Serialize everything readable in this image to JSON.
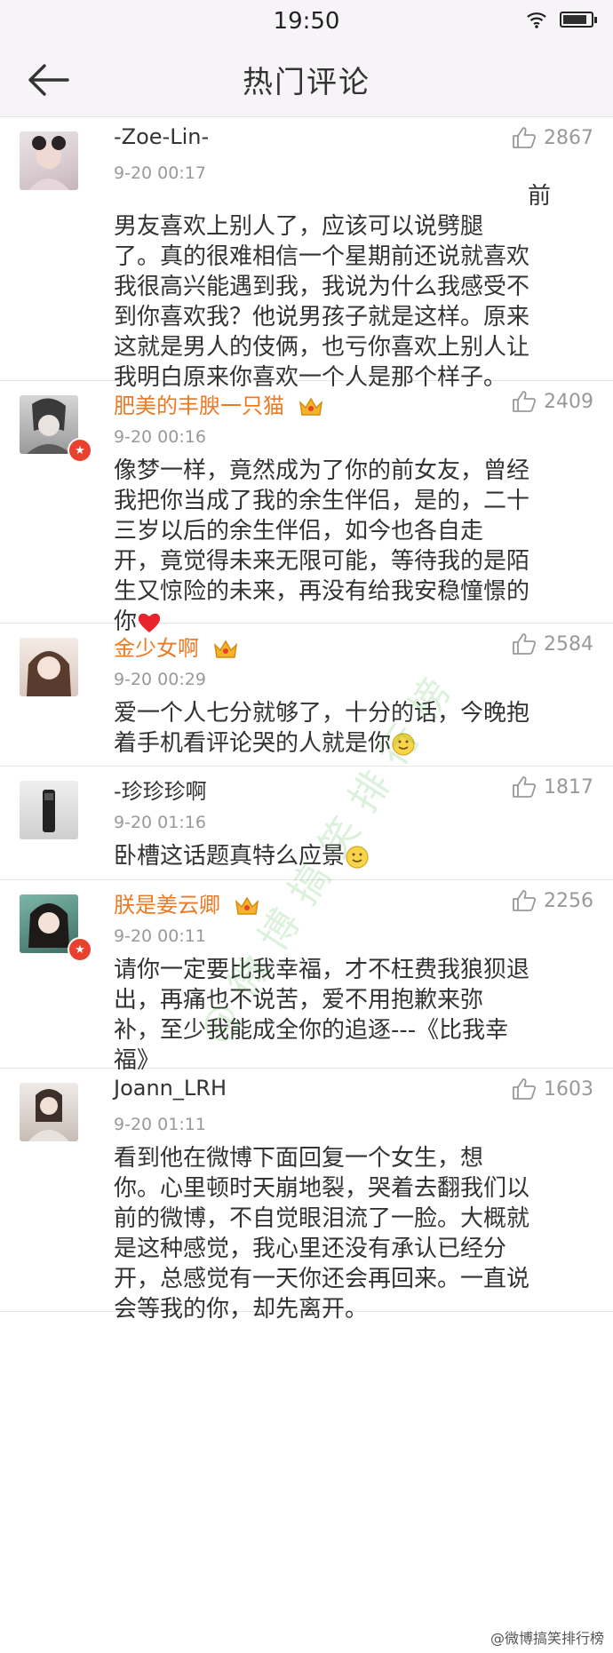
{
  "status": {
    "time": "19:50"
  },
  "header": {
    "title": "热门评论"
  },
  "comments": [
    {
      "name": "-Zoe-Lin-",
      "time": "9-20 00:17",
      "likes": "2867",
      "vip": false,
      "verified": false,
      "lines": [
        "前",
        "男友喜欢上别人了，应该可以说劈腿",
        "了。真的很难相信一个星期前还说就喜欢",
        "我很高兴能遇到我，我说为什么我感受不",
        "到你喜欢我？他说男孩子就是这样。原来",
        "这就是男人的伎俩，也亏你喜欢上别人让",
        "我明白原来你喜欢一个人是那个样子。"
      ]
    },
    {
      "name": "肥美的丰腴一只猫",
      "time": "9-20 00:16",
      "likes": "2409",
      "vip": true,
      "verified": true,
      "lines": [
        "像梦一样，竟然成为了你的前女友，曾经",
        "我把你当成了我的余生伴侣，是的，二十",
        "三岁以后的余生伴侣，如今也各自走",
        "开，竟觉得未来无限可能，等待我的是陌",
        "生又惊险的未来，再没有给我安稳憧憬的",
        "你"
      ]
    },
    {
      "name": "金少女啊",
      "time": "9-20 00:29",
      "likes": "2584",
      "vip": true,
      "verified": false,
      "lines": [
        "爱一个人七分就够了，十分的话，今晚抱",
        "着手机看评论哭的人就是你"
      ]
    },
    {
      "name": "-珍珍珍啊",
      "time": "9-20 01:16",
      "likes": "1817",
      "vip": false,
      "verified": false,
      "lines": [
        "卧槽这话题真特么应景"
      ]
    },
    {
      "name": "朕是姜云卿",
      "time": "9-20 00:11",
      "likes": "2256",
      "vip": true,
      "verified": true,
      "lines": [
        "请你一定要比我幸福，才不枉费我狼狈退",
        "出，再痛也不说苦，爱不用抱歉来弥",
        "补，至少我能成全你的追逐---《比我幸",
        "福》"
      ]
    },
    {
      "name": "Joann_LRH",
      "time": "9-20 01:11",
      "likes": "1603",
      "vip": false,
      "verified": false,
      "lines": [
        "看到他在微博下面回复一个女生，想",
        "你。心里顿时天崩地裂，哭着去翻我们以",
        "前的微博，不自觉眼泪流了一脸。大概就",
        "是这种感觉，我心里还没有承认已经分",
        "开，总感觉有一天你还会再回来。一直说",
        "会等我的你，却先离开。"
      ]
    }
  ],
  "watermark": "@微博搞笑排行榜",
  "footer": "@微博搞笑排行榜",
  "colors": {
    "vip_name": "#ec7a25",
    "heart": "#e8232d",
    "badge": "#e8412d"
  }
}
